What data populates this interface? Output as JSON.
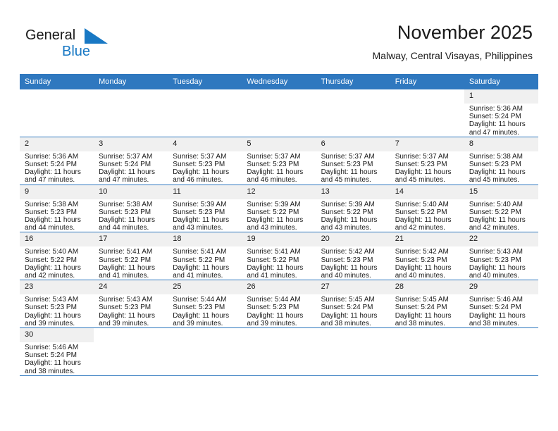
{
  "brand": {
    "name_part1": "General",
    "name_part2": "Blue"
  },
  "header": {
    "title": "November 2025",
    "subtitle": "Malway, Central Visayas, Philippines"
  },
  "colors": {
    "header_blue": "#2f78bf",
    "brand_blue": "#1878c4",
    "daynum_band": "#f0f0f0"
  },
  "weekday_headers": [
    "Sunday",
    "Monday",
    "Tuesday",
    "Wednesday",
    "Thursday",
    "Friday",
    "Saturday"
  ],
  "weeks": [
    [
      {
        "day": "",
        "sunrise": "",
        "sunset": "",
        "daylight_line1": "",
        "daylight_line2": ""
      },
      {
        "day": "",
        "sunrise": "",
        "sunset": "",
        "daylight_line1": "",
        "daylight_line2": ""
      },
      {
        "day": "",
        "sunrise": "",
        "sunset": "",
        "daylight_line1": "",
        "daylight_line2": ""
      },
      {
        "day": "",
        "sunrise": "",
        "sunset": "",
        "daylight_line1": "",
        "daylight_line2": ""
      },
      {
        "day": "",
        "sunrise": "",
        "sunset": "",
        "daylight_line1": "",
        "daylight_line2": ""
      },
      {
        "day": "",
        "sunrise": "",
        "sunset": "",
        "daylight_line1": "",
        "daylight_line2": ""
      },
      {
        "day": "1",
        "sunrise": "Sunrise: 5:36 AM",
        "sunset": "Sunset: 5:24 PM",
        "daylight_line1": "Daylight: 11 hours",
        "daylight_line2": "and 47 minutes."
      }
    ],
    [
      {
        "day": "2",
        "sunrise": "Sunrise: 5:36 AM",
        "sunset": "Sunset: 5:24 PM",
        "daylight_line1": "Daylight: 11 hours",
        "daylight_line2": "and 47 minutes."
      },
      {
        "day": "3",
        "sunrise": "Sunrise: 5:37 AM",
        "sunset": "Sunset: 5:24 PM",
        "daylight_line1": "Daylight: 11 hours",
        "daylight_line2": "and 47 minutes."
      },
      {
        "day": "4",
        "sunrise": "Sunrise: 5:37 AM",
        "sunset": "Sunset: 5:23 PM",
        "daylight_line1": "Daylight: 11 hours",
        "daylight_line2": "and 46 minutes."
      },
      {
        "day": "5",
        "sunrise": "Sunrise: 5:37 AM",
        "sunset": "Sunset: 5:23 PM",
        "daylight_line1": "Daylight: 11 hours",
        "daylight_line2": "and 46 minutes."
      },
      {
        "day": "6",
        "sunrise": "Sunrise: 5:37 AM",
        "sunset": "Sunset: 5:23 PM",
        "daylight_line1": "Daylight: 11 hours",
        "daylight_line2": "and 45 minutes."
      },
      {
        "day": "7",
        "sunrise": "Sunrise: 5:37 AM",
        "sunset": "Sunset: 5:23 PM",
        "daylight_line1": "Daylight: 11 hours",
        "daylight_line2": "and 45 minutes."
      },
      {
        "day": "8",
        "sunrise": "Sunrise: 5:38 AM",
        "sunset": "Sunset: 5:23 PM",
        "daylight_line1": "Daylight: 11 hours",
        "daylight_line2": "and 45 minutes."
      }
    ],
    [
      {
        "day": "9",
        "sunrise": "Sunrise: 5:38 AM",
        "sunset": "Sunset: 5:23 PM",
        "daylight_line1": "Daylight: 11 hours",
        "daylight_line2": "and 44 minutes."
      },
      {
        "day": "10",
        "sunrise": "Sunrise: 5:38 AM",
        "sunset": "Sunset: 5:23 PM",
        "daylight_line1": "Daylight: 11 hours",
        "daylight_line2": "and 44 minutes."
      },
      {
        "day": "11",
        "sunrise": "Sunrise: 5:39 AM",
        "sunset": "Sunset: 5:23 PM",
        "daylight_line1": "Daylight: 11 hours",
        "daylight_line2": "and 43 minutes."
      },
      {
        "day": "12",
        "sunrise": "Sunrise: 5:39 AM",
        "sunset": "Sunset: 5:22 PM",
        "daylight_line1": "Daylight: 11 hours",
        "daylight_line2": "and 43 minutes."
      },
      {
        "day": "13",
        "sunrise": "Sunrise: 5:39 AM",
        "sunset": "Sunset: 5:22 PM",
        "daylight_line1": "Daylight: 11 hours",
        "daylight_line2": "and 43 minutes."
      },
      {
        "day": "14",
        "sunrise": "Sunrise: 5:40 AM",
        "sunset": "Sunset: 5:22 PM",
        "daylight_line1": "Daylight: 11 hours",
        "daylight_line2": "and 42 minutes."
      },
      {
        "day": "15",
        "sunrise": "Sunrise: 5:40 AM",
        "sunset": "Sunset: 5:22 PM",
        "daylight_line1": "Daylight: 11 hours",
        "daylight_line2": "and 42 minutes."
      }
    ],
    [
      {
        "day": "16",
        "sunrise": "Sunrise: 5:40 AM",
        "sunset": "Sunset: 5:22 PM",
        "daylight_line1": "Daylight: 11 hours",
        "daylight_line2": "and 42 minutes."
      },
      {
        "day": "17",
        "sunrise": "Sunrise: 5:41 AM",
        "sunset": "Sunset: 5:22 PM",
        "daylight_line1": "Daylight: 11 hours",
        "daylight_line2": "and 41 minutes."
      },
      {
        "day": "18",
        "sunrise": "Sunrise: 5:41 AM",
        "sunset": "Sunset: 5:22 PM",
        "daylight_line1": "Daylight: 11 hours",
        "daylight_line2": "and 41 minutes."
      },
      {
        "day": "19",
        "sunrise": "Sunrise: 5:41 AM",
        "sunset": "Sunset: 5:22 PM",
        "daylight_line1": "Daylight: 11 hours",
        "daylight_line2": "and 41 minutes."
      },
      {
        "day": "20",
        "sunrise": "Sunrise: 5:42 AM",
        "sunset": "Sunset: 5:23 PM",
        "daylight_line1": "Daylight: 11 hours",
        "daylight_line2": "and 40 minutes."
      },
      {
        "day": "21",
        "sunrise": "Sunrise: 5:42 AM",
        "sunset": "Sunset: 5:23 PM",
        "daylight_line1": "Daylight: 11 hours",
        "daylight_line2": "and 40 minutes."
      },
      {
        "day": "22",
        "sunrise": "Sunrise: 5:43 AM",
        "sunset": "Sunset: 5:23 PM",
        "daylight_line1": "Daylight: 11 hours",
        "daylight_line2": "and 40 minutes."
      }
    ],
    [
      {
        "day": "23",
        "sunrise": "Sunrise: 5:43 AM",
        "sunset": "Sunset: 5:23 PM",
        "daylight_line1": "Daylight: 11 hours",
        "daylight_line2": "and 39 minutes."
      },
      {
        "day": "24",
        "sunrise": "Sunrise: 5:43 AM",
        "sunset": "Sunset: 5:23 PM",
        "daylight_line1": "Daylight: 11 hours",
        "daylight_line2": "and 39 minutes."
      },
      {
        "day": "25",
        "sunrise": "Sunrise: 5:44 AM",
        "sunset": "Sunset: 5:23 PM",
        "daylight_line1": "Daylight: 11 hours",
        "daylight_line2": "and 39 minutes."
      },
      {
        "day": "26",
        "sunrise": "Sunrise: 5:44 AM",
        "sunset": "Sunset: 5:23 PM",
        "daylight_line1": "Daylight: 11 hours",
        "daylight_line2": "and 39 minutes."
      },
      {
        "day": "27",
        "sunrise": "Sunrise: 5:45 AM",
        "sunset": "Sunset: 5:24 PM",
        "daylight_line1": "Daylight: 11 hours",
        "daylight_line2": "and 38 minutes."
      },
      {
        "day": "28",
        "sunrise": "Sunrise: 5:45 AM",
        "sunset": "Sunset: 5:24 PM",
        "daylight_line1": "Daylight: 11 hours",
        "daylight_line2": "and 38 minutes."
      },
      {
        "day": "29",
        "sunrise": "Sunrise: 5:46 AM",
        "sunset": "Sunset: 5:24 PM",
        "daylight_line1": "Daylight: 11 hours",
        "daylight_line2": "and 38 minutes."
      }
    ],
    [
      {
        "day": "30",
        "sunrise": "Sunrise: 5:46 AM",
        "sunset": "Sunset: 5:24 PM",
        "daylight_line1": "Daylight: 11 hours",
        "daylight_line2": "and 38 minutes."
      },
      {
        "day": "",
        "sunrise": "",
        "sunset": "",
        "daylight_line1": "",
        "daylight_line2": ""
      },
      {
        "day": "",
        "sunrise": "",
        "sunset": "",
        "daylight_line1": "",
        "daylight_line2": ""
      },
      {
        "day": "",
        "sunrise": "",
        "sunset": "",
        "daylight_line1": "",
        "daylight_line2": ""
      },
      {
        "day": "",
        "sunrise": "",
        "sunset": "",
        "daylight_line1": "",
        "daylight_line2": ""
      },
      {
        "day": "",
        "sunrise": "",
        "sunset": "",
        "daylight_line1": "",
        "daylight_line2": ""
      },
      {
        "day": "",
        "sunrise": "",
        "sunset": "",
        "daylight_line1": "",
        "daylight_line2": ""
      }
    ]
  ]
}
